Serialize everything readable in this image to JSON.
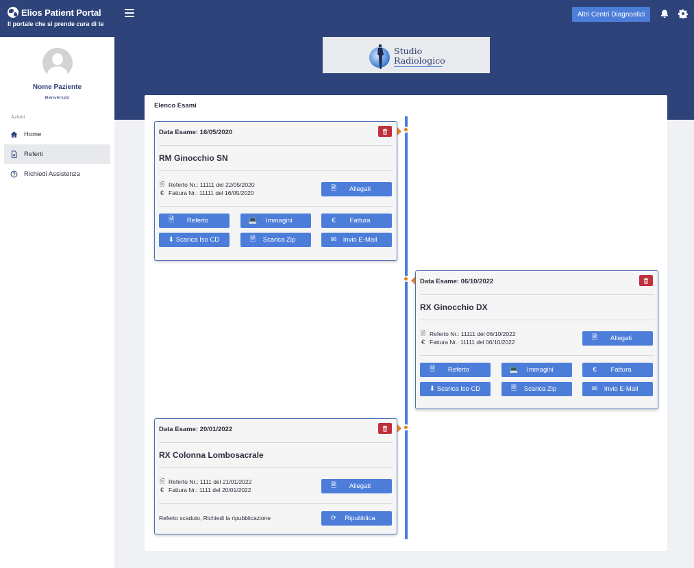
{
  "brand": {
    "title": "Elios Patient Portal",
    "subtitle_pre": "Il portale che si prende ",
    "subtitle_em": "cura",
    "subtitle_post": " di te"
  },
  "header": {
    "centers_button": "Altri Centri Diagnostici",
    "icons": [
      "menu-icon",
      "bell-icon",
      "gear-icon"
    ]
  },
  "sidebar": {
    "patient_name": "Nome Paziente",
    "welcome": "Benvenuto",
    "section_label": "Azioni",
    "items": [
      {
        "label": "Home",
        "icon": "home-icon",
        "active": false
      },
      {
        "label": "Referti",
        "icon": "file-icon",
        "active": true
      },
      {
        "label": "Richiedi Assistenza",
        "icon": "help-icon",
        "active": false
      }
    ]
  },
  "logo": {
    "line1": "Studio",
    "line2": "Radiologico"
  },
  "main": {
    "title": "Elenco Esami",
    "exams": [
      {
        "date": "Data Esame: 16/05/2020",
        "name": "RM Ginocchio SN",
        "referto": "Referto Nr.: 11111 del 22/05/2020",
        "fattura": "Fattura Nr.: 11111 del 16/05/2020",
        "allegati": "Allegati",
        "buttons": [
          "Referto",
          "Immagini",
          "Fattura",
          "Scarica Iso CD",
          "Scarica Zip",
          "Invio E-Mail"
        ]
      },
      {
        "date": "Data Esame: 06/10/2022",
        "name": "RX Ginocchio DX",
        "referto": "Referto Nr.: 11111 del 06/10/2022",
        "fattura": "Fattura Nr.: 11111 del 06/10/2022",
        "allegati": "Allegati",
        "buttons": [
          "Referto",
          "Immagini",
          "Fattura",
          "Scarica Iso CD",
          "Scarica Zip",
          "Invio E-Mail"
        ]
      },
      {
        "date": "Data Esame: 20/01/2022",
        "name": "RX Colonna Lombosacrale",
        "referto": "Referto Nr.: 1111 del 21/01/2022",
        "fattura": "Fattura Nr.: 1111 del 20/01/2022",
        "allegati": "Allegati",
        "expired_text": "Referto scaduto, Richiedi la ripubblicazione",
        "republish": "Ripubblica"
      }
    ]
  },
  "colors": {
    "header_bg": "#2d4379",
    "accent": "#4c7ed9",
    "danger": "#c0303b",
    "timeline_marker": "#e87d1e"
  }
}
